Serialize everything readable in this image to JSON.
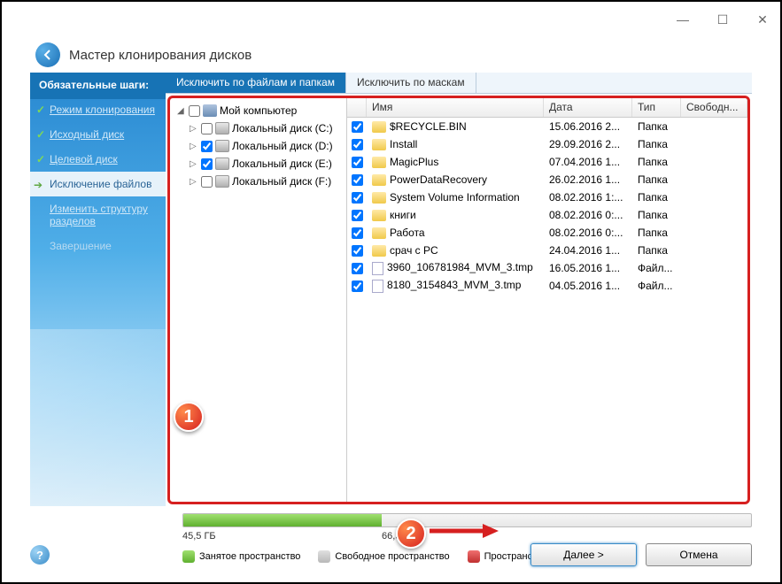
{
  "window": {
    "title": "Мастер клонирования дисков"
  },
  "sidebar": {
    "header": "Обязательные шаги:",
    "items": [
      {
        "label": "Режим клонирования",
        "done": true
      },
      {
        "label": "Исходный диск",
        "done": true
      },
      {
        "label": "Целевой диск",
        "done": true
      },
      {
        "label": "Исключение файлов",
        "active": true
      },
      {
        "label": "Изменить структуру разделов",
        "sub": true
      },
      {
        "label": "Завершение",
        "disabled": true
      }
    ]
  },
  "tabs": [
    {
      "label": "Исключить по файлам и папкам",
      "active": true
    },
    {
      "label": "Исключить по маскам"
    }
  ],
  "tree": {
    "root": "Мой компьютер",
    "children": [
      {
        "label": "Локальный диск (C:)",
        "checked": false
      },
      {
        "label": "Локальный диск (D:)",
        "checked": true
      },
      {
        "label": "Локальный диск (E:)",
        "checked": true
      },
      {
        "label": "Локальный диск (F:)",
        "checked": false
      }
    ]
  },
  "list": {
    "columns": {
      "name": "Имя",
      "date": "Дата",
      "type": "Тип",
      "free": "Свободн..."
    },
    "rows": [
      {
        "checked": true,
        "icon": "folder",
        "name": "$RECYCLE.BIN",
        "date": "15.06.2016 2...",
        "type": "Папка"
      },
      {
        "checked": true,
        "icon": "folder",
        "name": "Install",
        "date": "29.09.2016 2...",
        "type": "Папка"
      },
      {
        "checked": true,
        "icon": "folder",
        "name": "MagicPlus",
        "date": "07.04.2016 1...",
        "type": "Папка"
      },
      {
        "checked": true,
        "icon": "folder",
        "name": "PowerDataRecovery",
        "date": "26.02.2016 1...",
        "type": "Папка"
      },
      {
        "checked": true,
        "icon": "folder",
        "name": "System Volume Information",
        "date": "08.02.2016 1:...",
        "type": "Папка"
      },
      {
        "checked": true,
        "icon": "folder",
        "name": "книги",
        "date": "08.02.2016 0:...",
        "type": "Папка"
      },
      {
        "checked": true,
        "icon": "folder",
        "name": "Работа",
        "date": "08.02.2016 0:...",
        "type": "Папка"
      },
      {
        "checked": true,
        "icon": "folder",
        "name": "срач с PC",
        "date": "24.04.2016 1...",
        "type": "Папка"
      },
      {
        "checked": true,
        "icon": "file",
        "name": "3960_106781984_MVM_3.tmp",
        "date": "16.05.2016 1...",
        "type": "Файл..."
      },
      {
        "checked": true,
        "icon": "file",
        "name": "8180_3154843_MVM_3.tmp",
        "date": "04.05.2016 1...",
        "type": "Файл..."
      }
    ]
  },
  "progress": {
    "used": "45,5 ГБ",
    "total": "66,3 ГБ",
    "percent": 35
  },
  "legend": {
    "used": "Занятое пространство",
    "free": "Свободное пространство",
    "excluded": "Пространство для исключения"
  },
  "buttons": {
    "next": "Далее >",
    "cancel": "Отмена"
  },
  "annotations": {
    "badge1": "1",
    "badge2": "2"
  }
}
